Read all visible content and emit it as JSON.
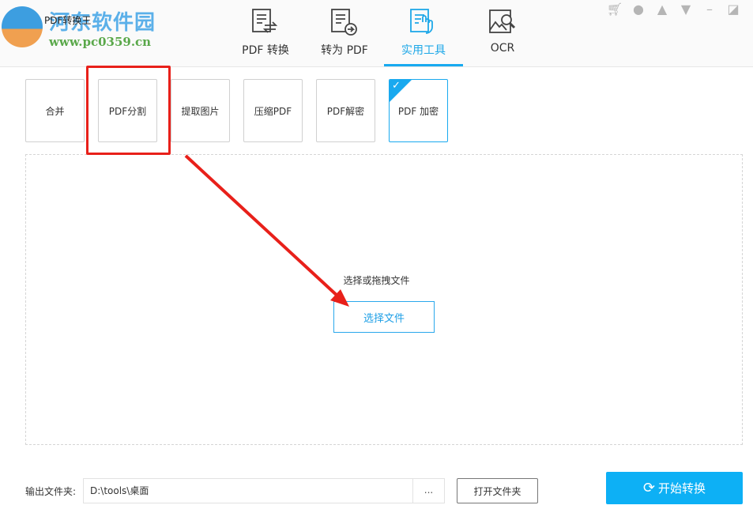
{
  "header": {
    "app_title": "PDF转换王",
    "watermark_name": "河东软件园",
    "watermark_url": "www.pc0359.cn",
    "tabs": [
      {
        "label": "PDF 转换",
        "icon": "doc-convert-icon"
      },
      {
        "label": "转为 PDF",
        "icon": "doc-arrow-icon"
      },
      {
        "label": "实用工具",
        "icon": "doc-hand-icon",
        "active": true
      },
      {
        "label": "OCR",
        "icon": "image-search-icon"
      }
    ]
  },
  "tools": [
    {
      "label": "合并"
    },
    {
      "label": "PDF分割"
    },
    {
      "label": "提取图片"
    },
    {
      "label": "压缩PDF"
    },
    {
      "label": "PDF解密"
    },
    {
      "label": "PDF 加密",
      "selected": true
    }
  ],
  "drop": {
    "hint": "选择或拖拽文件",
    "button": "选择文件"
  },
  "footer": {
    "output_label": "输出文件夹:",
    "output_path": "D:\\tools\\桌面",
    "browse": "...",
    "open_folder": "打开文件夹",
    "start": "开始转换"
  },
  "colors": {
    "accent": "#0db0f5",
    "annotation": "#e8201a"
  }
}
